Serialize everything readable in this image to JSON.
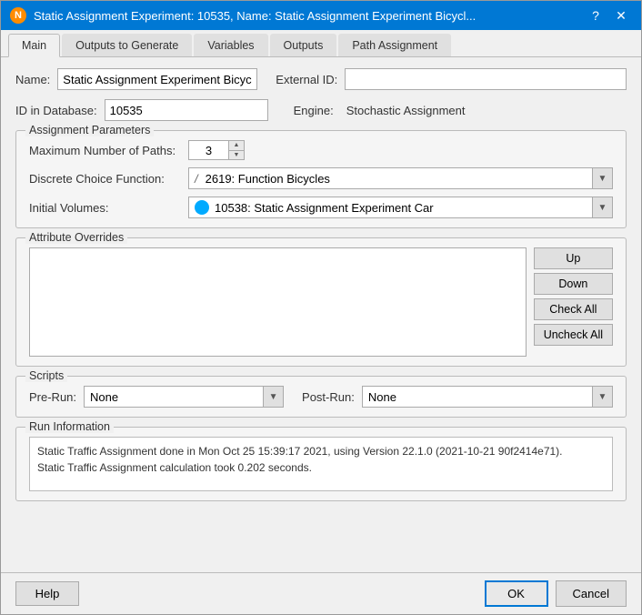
{
  "titleBar": {
    "icon": "N",
    "title": "Static Assignment Experiment: 10535, Name: Static Assignment Experiment Bicycl...",
    "helpBtn": "?",
    "closeBtn": "✕"
  },
  "tabs": [
    {
      "label": "Main",
      "active": true
    },
    {
      "label": "Outputs to Generate",
      "active": false
    },
    {
      "label": "Variables",
      "active": false
    },
    {
      "label": "Outputs",
      "active": false
    },
    {
      "label": "Path Assignment",
      "active": false
    }
  ],
  "form": {
    "nameLabel": "Name:",
    "nameValue": "Static Assignment Experiment Bicycle",
    "externalIdLabel": "External ID:",
    "externalIdValue": "",
    "dbIdLabel": "ID in Database:",
    "dbIdValue": "10535",
    "engineLabel": "Engine:",
    "engineValue": "Stochastic Assignment"
  },
  "assignmentParams": {
    "title": "Assignment Parameters",
    "maxPathsLabel": "Maximum Number of Paths:",
    "maxPathsValue": "3",
    "discreteChoiceLabel": "Discrete Choice Function:",
    "discreteChoiceValue": "2619: Function Bicycles",
    "initialVolumesLabel": "Initial Volumes:",
    "initialVolumesValue": "10538: Static Assignment Experiment Car"
  },
  "attributeOverrides": {
    "title": "Attribute Overrides",
    "upBtn": "Up",
    "downBtn": "Down",
    "checkAllBtn": "Check All",
    "uncheckAllBtn": "Uncheck All"
  },
  "scripts": {
    "title": "Scripts",
    "preRunLabel": "Pre-Run:",
    "preRunValue": "None",
    "postRunLabel": "Post-Run:",
    "postRunValue": "None"
  },
  "runInfo": {
    "title": "Run Information",
    "text": "Static Traffic Assignment done in Mon Oct 25 15:39:17 2021, using Version 22.1.0 (2021-10-21 90f2414e71).\nStatic Traffic Assignment calculation took 0.202 seconds."
  },
  "buttons": {
    "help": "Help",
    "ok": "OK",
    "cancel": "Cancel"
  }
}
